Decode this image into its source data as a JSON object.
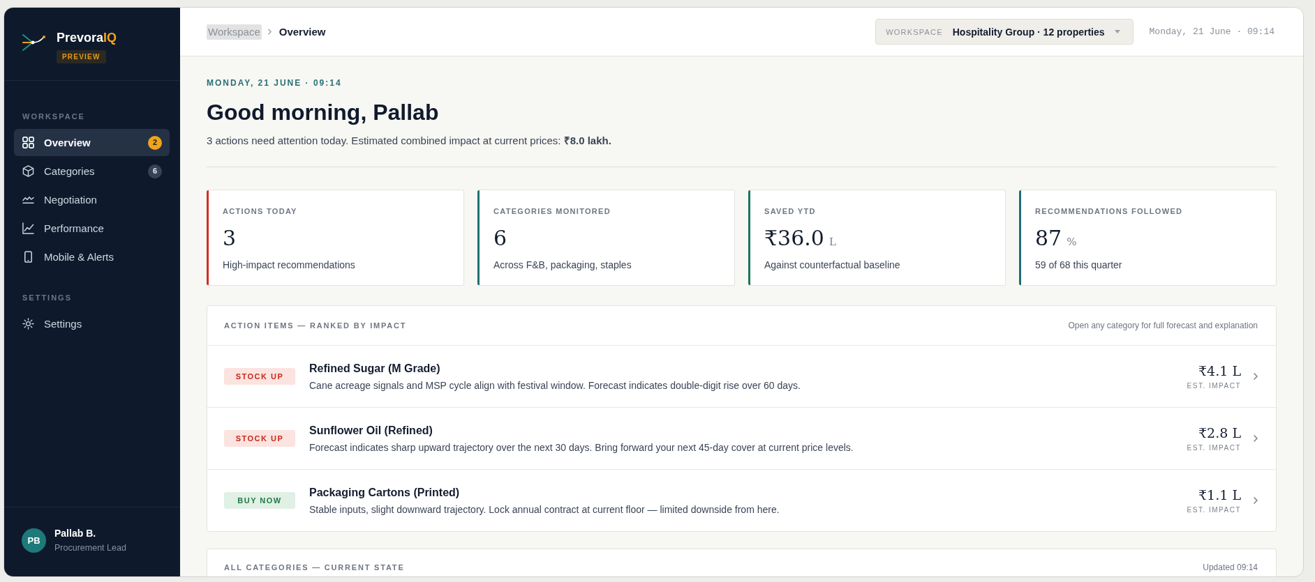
{
  "sidebar": {
    "brand": {
      "name": "Prevora",
      "accent": "IQ",
      "badge": "PREVIEW"
    },
    "sections": [
      {
        "title": "WORKSPACE",
        "items": [
          {
            "label": "Overview",
            "selected": true,
            "badge": {
              "text": "2",
              "kind": "alert"
            }
          },
          {
            "label": "Categories",
            "selected": false,
            "badge": {
              "text": "6",
              "kind": "count"
            }
          },
          {
            "label": "Negotiation",
            "selected": false
          },
          {
            "label": "Performance",
            "selected": false
          },
          {
            "label": "Mobile & Alerts",
            "selected": false
          }
        ]
      },
      {
        "title": "SETTINGS",
        "items": [
          {
            "label": "Settings",
            "selected": false
          }
        ]
      }
    ],
    "user": {
      "initials": "PB",
      "name": "Pallab B.",
      "role": "Procurement Lead"
    }
  },
  "topbar": {
    "breadcrumb": [
      {
        "label": "Workspace",
        "current": false,
        "highlighted": true
      },
      {
        "label": "Overview",
        "current": true,
        "highlighted": false
      }
    ],
    "workspace_selector": {
      "label": "WORKSPACE",
      "value": "Hospitality Group · 12 properties"
    },
    "datetime": "Monday, 21 June · 09:14"
  },
  "greeting": {
    "date": "MONDAY, 21 JUNE · 09:14",
    "title": "Good morning, Pallab",
    "summary": "3 actions need attention today. Estimated combined impact at current prices: **₹8.0 lakh.**"
  },
  "kpis": [
    {
      "label": "ACTIONS TODAY",
      "value": "3",
      "note": "High-impact recommendations",
      "color": "#d42c1f"
    },
    {
      "label": "CATEGORIES MONITORED",
      "value": "6",
      "note": "Across F&B, packaging, staples",
      "color": "#1e6d73"
    },
    {
      "label": "SAVED YTD",
      "value": "₹36.0",
      "unit": "L",
      "note": "Against counterfactual baseline",
      "color": "#17775c"
    },
    {
      "label": "RECOMMENDATIONS FOLLOWED",
      "value": "87",
      "unit": "%",
      "note": "59 of 68 this quarter",
      "color": "#1e6d73"
    }
  ],
  "action_items": {
    "title": "ACTION ITEMS — RANKED BY IMPACT",
    "hint": "Open any category for full forecast and explanation",
    "rows": [
      {
        "badge": {
          "text": "STOCK UP",
          "kind": "warn"
        },
        "title": "Refined Sugar (M Grade)",
        "description": "Cane acreage signals and MSP cycle align with festival window. Forecast indicates double-digit rise over 60 days.",
        "impact": "₹4.1 L",
        "impact_label": "EST. IMPACT"
      },
      {
        "badge": {
          "text": "STOCK UP",
          "kind": "warn"
        },
        "title": "Sunflower Oil (Refined)",
        "description": "Forecast indicates sharp upward trajectory over the next 30 days. Bring forward your next 45-day cover at current price levels.",
        "impact": "₹2.8 L",
        "impact_label": "EST. IMPACT"
      },
      {
        "badge": {
          "text": "BUY NOW",
          "kind": "good"
        },
        "title": "Packaging Cartons (Printed)",
        "description": "Stable inputs, slight downward trajectory. Lock annual contract at current floor — limited downside from here.",
        "impact": "₹1.1 L",
        "impact_label": "EST. IMPACT"
      }
    ]
  },
  "all_categories": {
    "title": "ALL CATEGORIES — CURRENT STATE",
    "updated": "Updated 09:14"
  }
}
